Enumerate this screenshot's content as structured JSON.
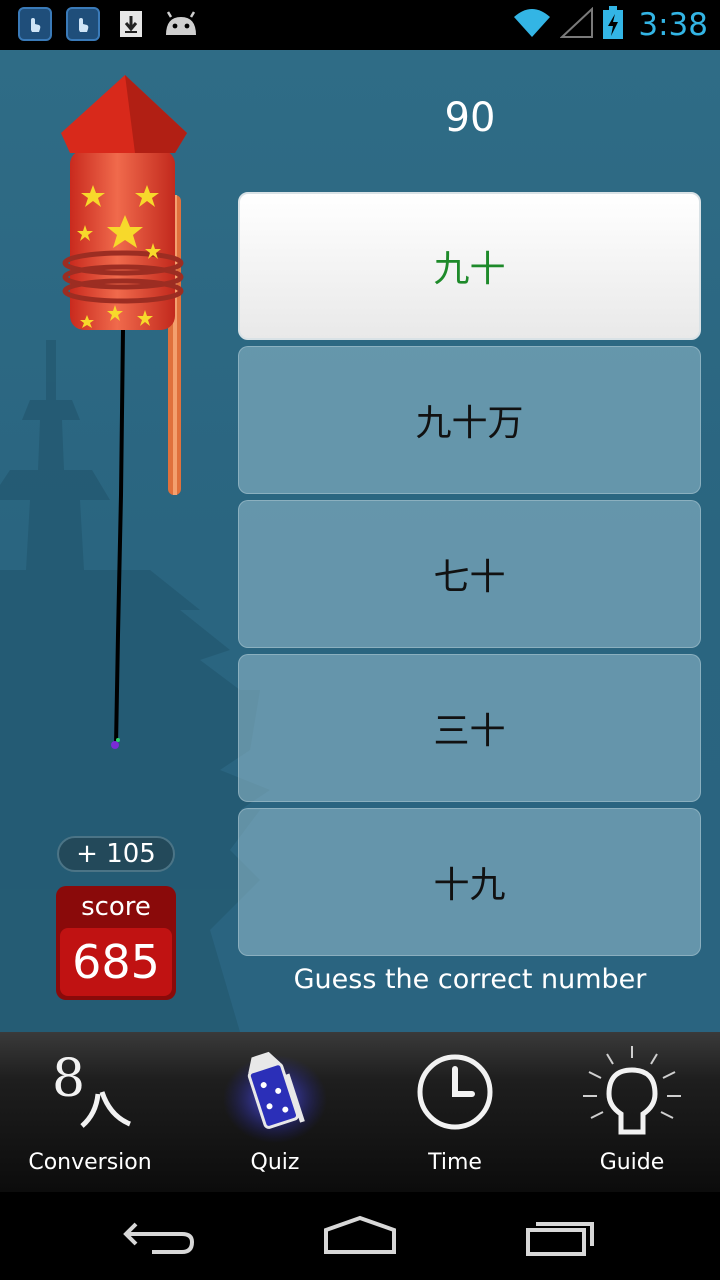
{
  "status_bar": {
    "time": "3:38",
    "icons": [
      "touch-app-icon",
      "touch-app-icon",
      "download-icon",
      "android-icon",
      "wifi-icon",
      "signal-icon",
      "battery-charging-icon"
    ]
  },
  "quiz": {
    "number": "90",
    "options": [
      {
        "label": "九十",
        "state": "correct"
      },
      {
        "label": "九十万",
        "state": "normal"
      },
      {
        "label": "七十",
        "state": "normal"
      },
      {
        "label": "三十",
        "state": "normal"
      },
      {
        "label": "十九",
        "state": "normal"
      }
    ],
    "hint": "Guess the correct number",
    "bonus": "+ 105",
    "score_label": "score",
    "score_value": "685"
  },
  "tabs": [
    {
      "label": "Conversion",
      "icon": "conversion-icon",
      "active": false
    },
    {
      "label": "Quiz",
      "icon": "firework-rocket-icon",
      "active": true
    },
    {
      "label": "Time",
      "icon": "clock-icon",
      "active": false
    },
    {
      "label": "Guide",
      "icon": "lightbulb-icon",
      "active": false
    }
  ],
  "colors": {
    "background": "#2c6883",
    "correct_text": "#1e8a2a",
    "score_red": "#c01212",
    "status_accent": "#33b5e5"
  }
}
